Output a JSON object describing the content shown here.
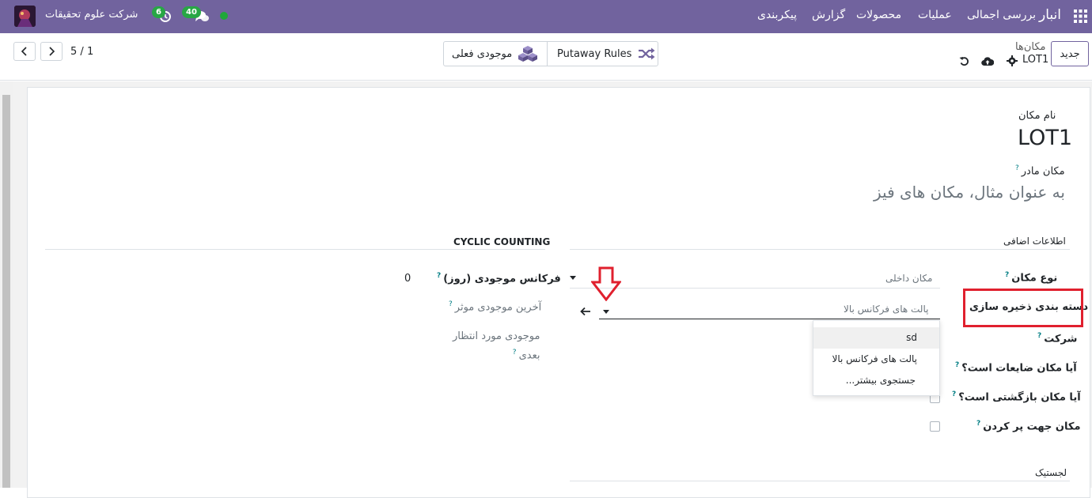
{
  "navbar": {
    "app_name": "انبار",
    "menu": [
      "بررسی اجمالی",
      "عملیات",
      "محصولات",
      "گزارش",
      "پیکربندی"
    ],
    "company": "شرکت علوم تحقیقات",
    "messages_count": "40",
    "activities_count": "6",
    "brand_color": "#71639e"
  },
  "control": {
    "breadcrumb_parent": "مکان‌ها",
    "breadcrumb_current": "LOT1",
    "new_label": "جدید",
    "pager_value": "1 / 5",
    "putaway_label": "Putaway Rules",
    "stock_label": "موجودی فعلی"
  },
  "form": {
    "name_label": "نام مکان",
    "name_value": "LOT1",
    "parent_label": "مکان مادر",
    "parent_placeholder": "به عنوان مثال، مکان های فیز",
    "additional_info_title": "اطلاعات اضافی",
    "cyclic_counting_title": "CYCLIC COUNTING",
    "location_type_label": "نوع مکان",
    "location_type_value": "مکان داخلی",
    "storage_category_label": "دسته بندی ذخیره سازی",
    "storage_category_value": "پالت های فرکانس بالا",
    "company_label": "شرکت",
    "scrap_label": "آیا مکان ضایعات است؟",
    "return_label": "آیا مکان بازگشتی است؟",
    "replenish_label": "مکان جهت پر کردن",
    "logistics_title": "لجستیک",
    "inventory_freq_label": "فرکانس موجودی (روز)",
    "inventory_freq_value": "0",
    "last_inventory_label": "آخرین موجودی موثر",
    "next_inventory_label_1": "موجودی مورد انتظار",
    "next_inventory_label_2": "بعدی"
  },
  "dropdown": {
    "items": [
      "sd",
      "پالت های فرکانس بالا"
    ],
    "search_more": "جستجوی بیشتر..."
  },
  "colors": {
    "highlight": "#e0202e",
    "help": "#017e84",
    "badge": "#28a745",
    "presence": "#1fa83a"
  }
}
